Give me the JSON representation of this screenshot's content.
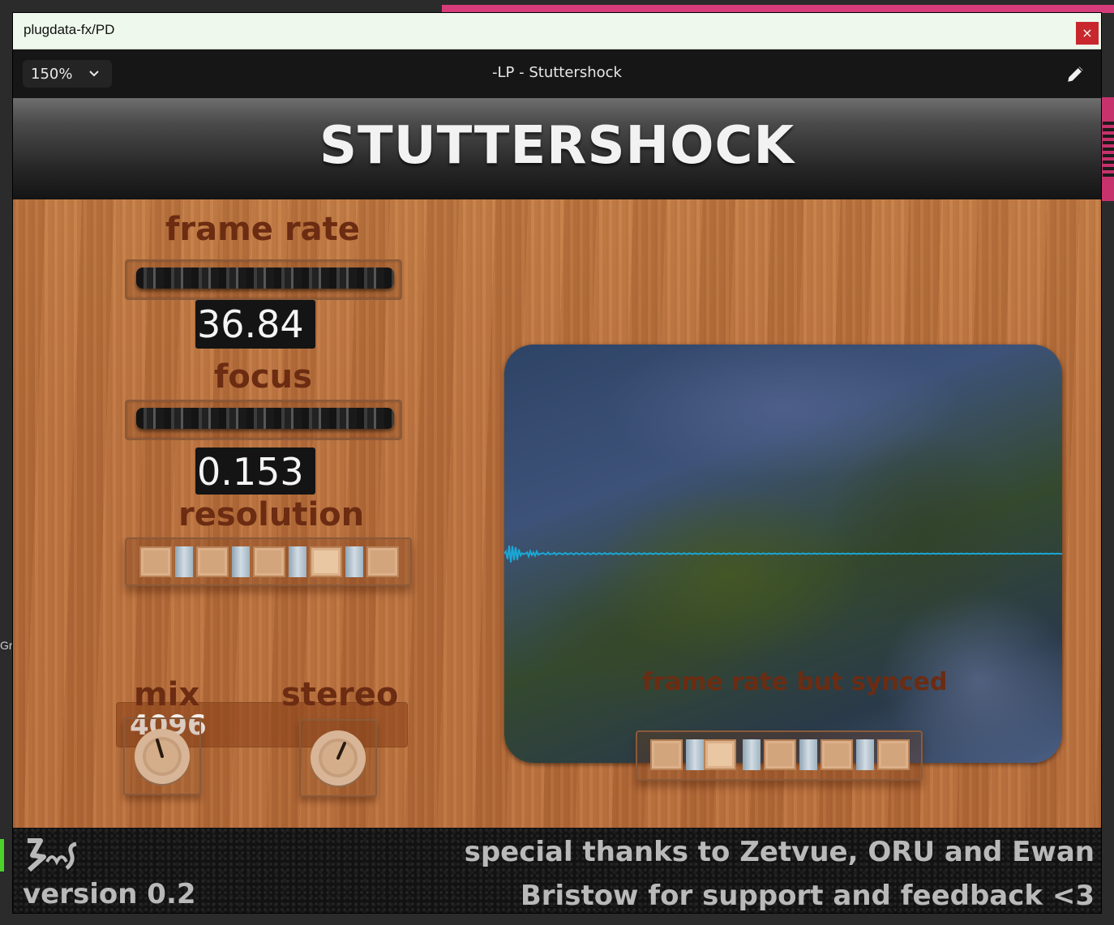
{
  "window": {
    "title": "plugdata-fx/PD",
    "close_glyph": "×"
  },
  "toolbar": {
    "zoom_value": "150%",
    "patch_title": "-LP - Stuttershock",
    "edit_icon": "pencil-icon"
  },
  "plugin": {
    "brand": "STUTTERSHOCK",
    "frame_rate": {
      "label": "frame rate",
      "value": "36.84"
    },
    "focus": {
      "label": "focus",
      "value": "0.153"
    },
    "resolution": {
      "label": "resolution",
      "value": "4096",
      "selected_index": 3,
      "options_count": 5
    },
    "mix": {
      "label": "mix"
    },
    "stereo": {
      "label": "stereo"
    },
    "synced": {
      "label": "frame rate but synced",
      "selected_index": 1,
      "options_count": 5
    },
    "waveform_color": "#1aa8d6"
  },
  "footer": {
    "version": "version 0.2",
    "thanks_line1": "special thanks to Zetvue, ORU and Ewan",
    "thanks_line2": "Bristow for support and feedback <3"
  },
  "host": {
    "side_text": "Gr"
  }
}
